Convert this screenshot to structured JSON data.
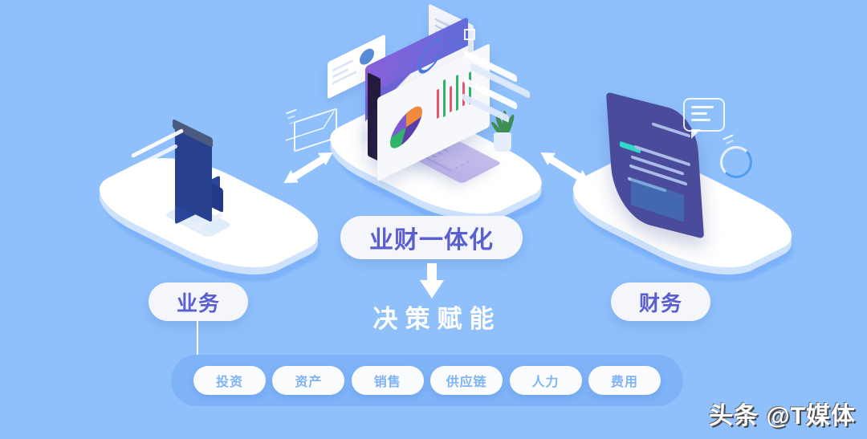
{
  "meta": {
    "background_color": "#8fc0fc",
    "accent_color": "#5a5fd0",
    "tag_bar_color": "#7eb3f8",
    "pill_color": "#f4f6fb",
    "tag_text_color": "#7fb3f5",
    "white": "#ffffff"
  },
  "center": {
    "title": "业财一体化",
    "caption": "决策赋能"
  },
  "nodes": {
    "left": {
      "label": "业务",
      "icon": "office-chair-icon"
    },
    "right": {
      "label": "财务",
      "icon": "document-report-icon"
    }
  },
  "tags": [
    {
      "label": "投资"
    },
    {
      "label": "资产"
    },
    {
      "label": "销售"
    },
    {
      "label": "供应链"
    },
    {
      "label": "人力"
    },
    {
      "label": "费用"
    }
  ],
  "icons": {
    "envelope": "envelope-icon",
    "speech_bubble": "speech-bubble-icon",
    "refresh_ring": "refresh-ring-icon",
    "arrow_left": "double-arrow-left-icon",
    "arrow_right": "double-arrow-right-icon",
    "arrow_down": "arrow-down-icon",
    "plant": "potted-plant-icon",
    "laptop": "laptop-dashboard-icon",
    "pie": "pie-chart-icon",
    "gauge": "gauge-icon",
    "candlestick": "candlestick-chart-icon"
  },
  "watermark": {
    "text": "头条 @T媒体"
  }
}
